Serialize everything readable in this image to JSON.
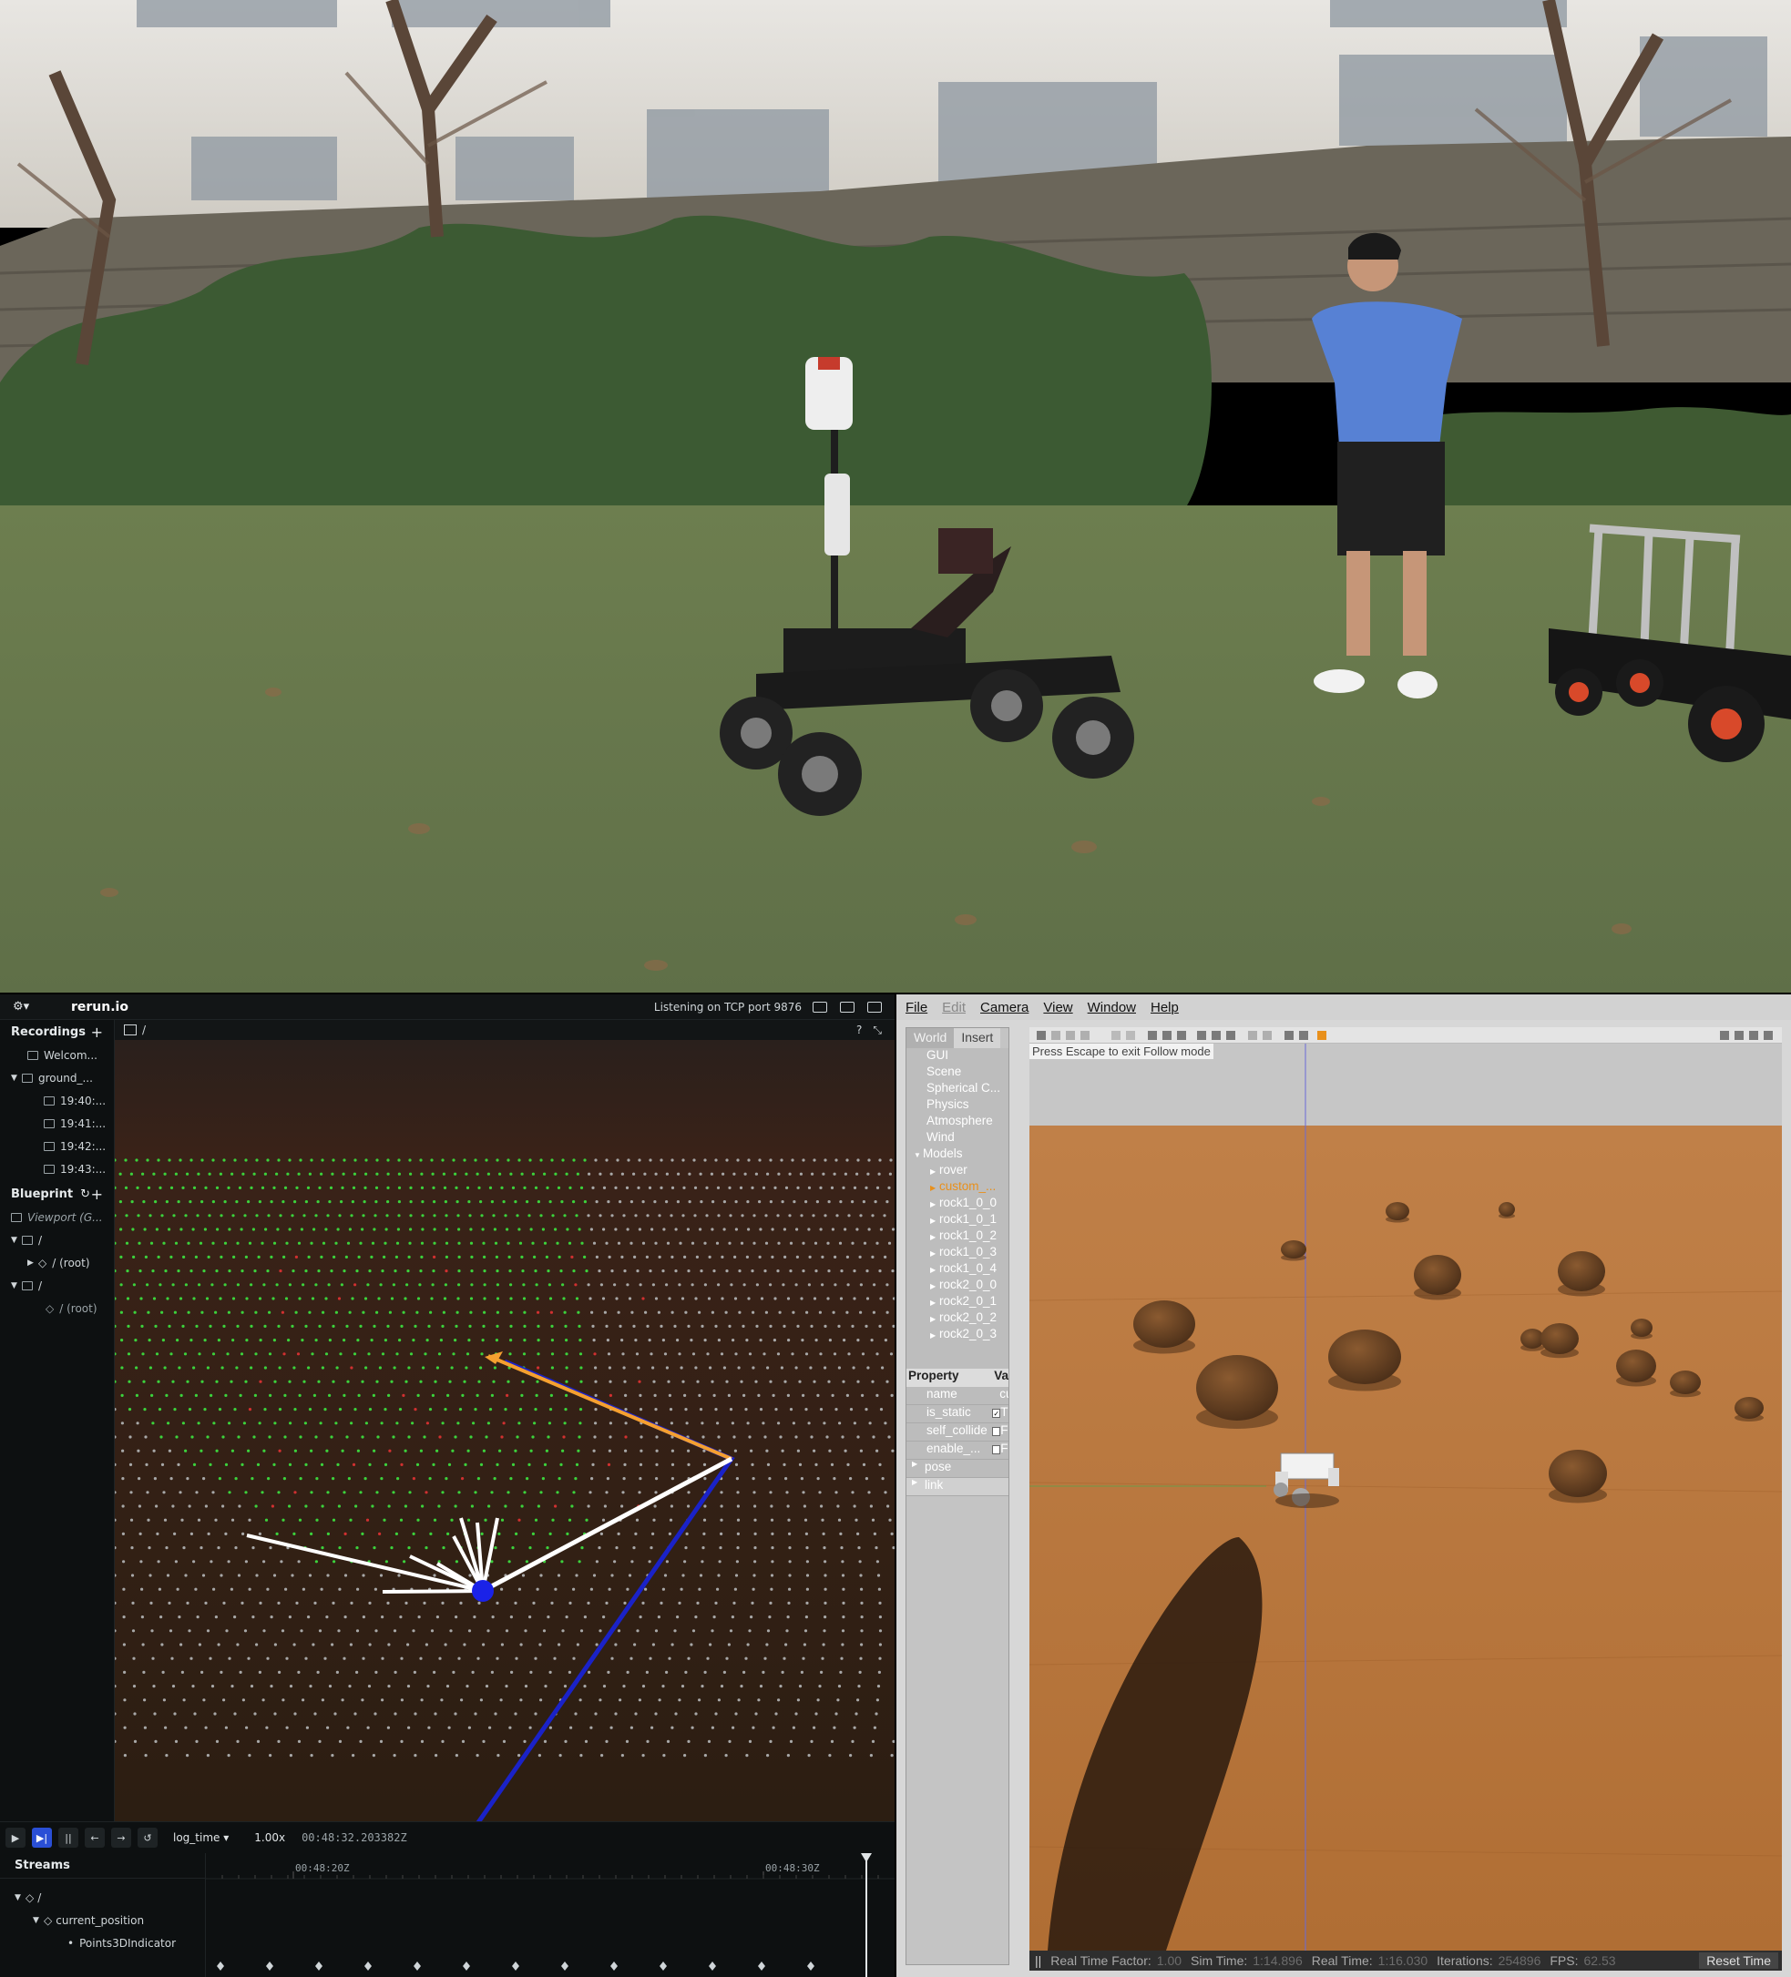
{
  "rerun": {
    "brand": "rerun.io",
    "status": "Listening on TCP port 9876",
    "viewport_path": "/",
    "help_mark": "?",
    "recordings": {
      "title": "Recordings",
      "items": [
        "Welcom...",
        "ground_...",
        "19:40:...",
        "19:41:...",
        "19:42:...",
        "19:43:..."
      ]
    },
    "blueprint": {
      "title": "Blueprint",
      "items": [
        "Viewport (G...",
        "/",
        "/ (root)",
        "/",
        "/ (root)"
      ]
    },
    "timeline": {
      "timeline_name": "log_time",
      "speed": "1.00x",
      "current_time": "00:48:32.203382Z",
      "streams_title": "Streams",
      "stream_items": [
        "/",
        "current_position",
        "Points3DIndicator"
      ],
      "tick_labels": [
        "00:48:20Z",
        "00:48:30Z"
      ]
    }
  },
  "gazebo": {
    "menus": [
      "File",
      "Edit",
      "Camera",
      "View",
      "Window",
      "Help"
    ],
    "tabs": [
      "World",
      "Insert"
    ],
    "world_items": [
      "GUI",
      "Scene",
      "Spherical C...",
      "Physics",
      "Atmosphere",
      "Wind",
      "Models",
      "rover",
      "custom_...",
      "rock1_0_0",
      "rock1_0_1",
      "rock1_0_2",
      "rock1_0_3",
      "rock1_0_4",
      "rock2_0_0",
      "rock2_0_1",
      "rock2_0_2",
      "rock2_0_3"
    ],
    "property_header": [
      "Property",
      "Va"
    ],
    "properties": [
      {
        "name": "name",
        "value": "cu"
      },
      {
        "name": "is_static",
        "value": "T"
      },
      {
        "name": "self_collide",
        "value": "F"
      },
      {
        "name": "enable_...",
        "value": "F"
      },
      {
        "name": "pose",
        "value": ""
      },
      {
        "name": "link",
        "value": ""
      }
    ],
    "escape_hint": "Press Escape to exit Follow mode",
    "status": {
      "rtf_label": "Real Time Factor:",
      "rtf_value": "1.00",
      "sim_label": "Sim Time:",
      "sim_value": "1:14.896",
      "real_label": "Real Time:",
      "real_value": "1:16.030",
      "iter_label": "Iterations:",
      "iter_value": "254896",
      "fps_label": "FPS:",
      "fps_value": "62.53",
      "reset_label": "Reset Time"
    }
  },
  "colors": {
    "rerun_bg": "#0d1011",
    "rerun_accent": "#2a4fd6",
    "path_orange": "#f5a030",
    "path_blue": "#1a22c8",
    "gazebo_ground": "#b8793c",
    "custom_model": "#e8901c"
  }
}
